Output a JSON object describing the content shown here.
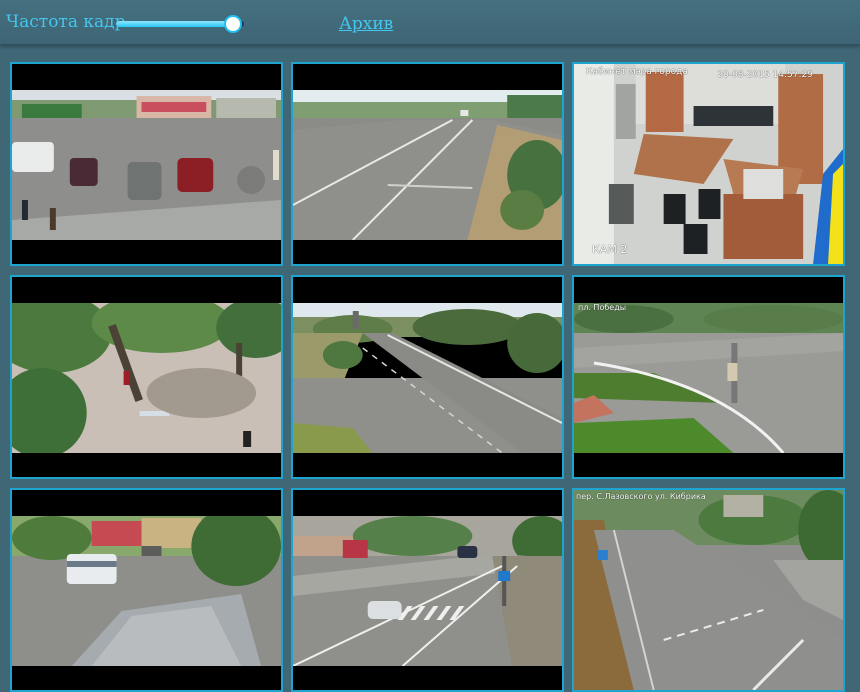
{
  "toolbar": {
    "fps_label": "Частота кадр",
    "fps_slider_value": 0.9,
    "archive_link": "Архив"
  },
  "cameras": [
    {
      "scene": "market-square-parking"
    },
    {
      "scene": "highway-road"
    },
    {
      "scene": "mayor-office",
      "overlay_title": "Кабинет мэра города",
      "overlay_time": "20-08-2015 14:57:29",
      "overlay_cam": "КАМ 2"
    },
    {
      "scene": "park-trees"
    },
    {
      "scene": "highway-curve"
    },
    {
      "scene": "street-intersection",
      "overlay_title": "пл. Победы"
    },
    {
      "scene": "bus-station"
    },
    {
      "scene": "crosswalk-street"
    },
    {
      "scene": "crossroad",
      "overlay_title": "пер. С.Лазовского ул. Кибрика"
    }
  ],
  "colors": {
    "page_background": "#3f6776",
    "accent": "#43c7ee",
    "tile_border": "#1fa3cf"
  }
}
